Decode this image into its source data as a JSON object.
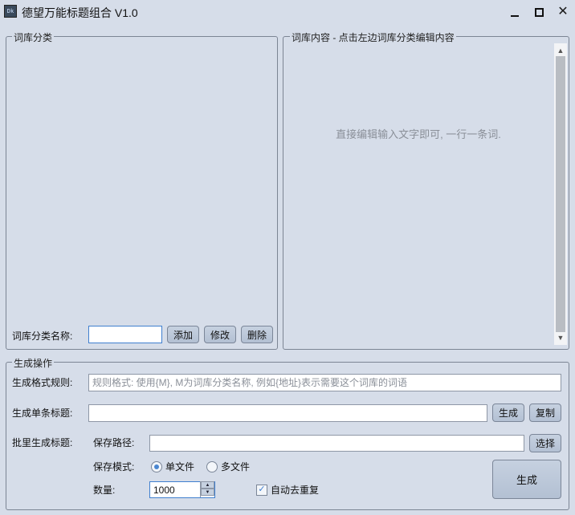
{
  "window": {
    "icon_text": "Dk",
    "title": "德望万能标题组合 V1.0"
  },
  "category_panel": {
    "legend": "词库分类",
    "name_label": "词库分类名称:",
    "name_value": "",
    "add_label": "添加",
    "edit_label": "修改",
    "delete_label": "删除"
  },
  "content_panel": {
    "legend": "词库内容 - 点击左边词库分类编辑内容",
    "placeholder": "直接编辑输入文字即可, 一行一条词."
  },
  "generate_panel": {
    "legend": "生成操作",
    "format_label": "生成格式规则:",
    "format_placeholder": "规则格式: 使用{M}, M为词库分类名称, 例如{地址}表示需要这个词库的词语",
    "single_label": "生成单条标题:",
    "single_value": "",
    "single_generate_label": "生成",
    "copy_label": "复制",
    "batch_label": "批里生成标题:",
    "save_path_label": "保存路径:",
    "save_path_value": "",
    "choose_label": "选择",
    "save_mode_label": "保存模式:",
    "mode_single_label": "单文件",
    "mode_multi_label": "多文件",
    "mode_selected": "单文件",
    "count_label": "数量:",
    "count_value": "1000",
    "dedupe_label": "自动去重复",
    "dedupe_checked": true,
    "batch_generate_label": "生成"
  }
}
